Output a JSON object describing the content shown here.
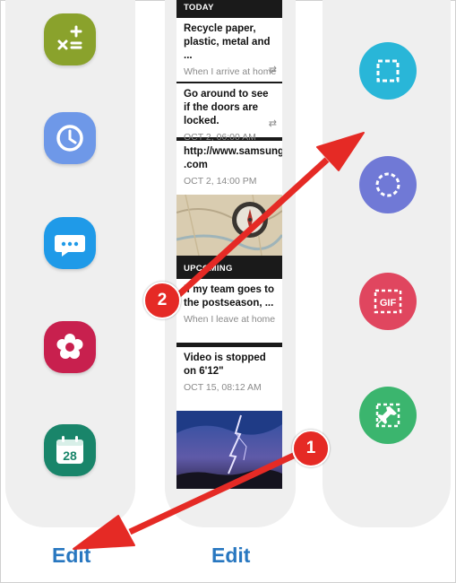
{
  "apps": [
    {
      "name": "calculator-app-icon",
      "color": "#8aa22c"
    },
    {
      "name": "clock-app-icon",
      "color": "#6e98e8"
    },
    {
      "name": "messages-app-icon",
      "color": "#1f9ae8"
    },
    {
      "name": "gallery-app-icon",
      "color": "#c8204e"
    },
    {
      "name": "calendar-app-icon",
      "color": "#19856a",
      "day": "28"
    }
  ],
  "apps_edit_label": "Edit",
  "reminders": {
    "today_header": "TODAY",
    "upcoming_header": "UPCOMING",
    "items": [
      {
        "title": "Recycle paper, plastic, metal and ...",
        "subtitle": "When I arrive at home"
      },
      {
        "title": "Go around to see if the doors are locked.",
        "subtitle": "OCT 2, 06:00 AM"
      },
      {
        "title": "http://www.samsung .com",
        "subtitle": "OCT 2, 14:00 PM"
      },
      {
        "title": "If my team goes to the postseason, ...",
        "subtitle": "When I leave at home"
      },
      {
        "title": "Video is stopped on 6'12\"",
        "subtitle": "OCT 15, 08:12 AM"
      }
    ],
    "edit_label": "Edit"
  },
  "smart_select": [
    {
      "name": "rectangle-select-icon",
      "color": "#29b6d8"
    },
    {
      "name": "oval-select-icon",
      "color": "#7079d6"
    },
    {
      "name": "gif-capture-icon",
      "color": "#e0465f",
      "text": "GIF"
    },
    {
      "name": "pin-to-screen-icon",
      "color": "#3bb56e"
    }
  ],
  "callouts": [
    {
      "number": "1"
    },
    {
      "number": "2"
    }
  ],
  "colors": {
    "accent": "#2877c0",
    "callout": "#e52a25",
    "panel": "#efefef"
  }
}
